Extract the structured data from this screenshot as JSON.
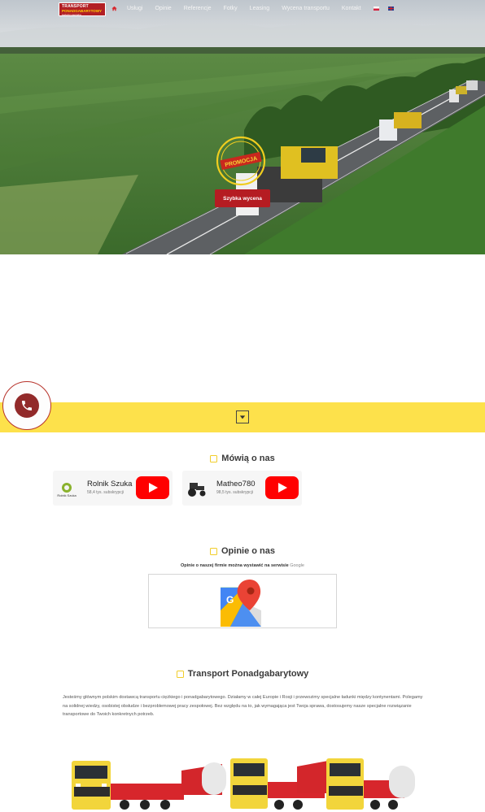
{
  "header": {
    "logo": {
      "line1": "TRANSPORT",
      "line2": "PONADGABARYTOWY",
      "line3": "Ładunki specjalne"
    },
    "nav": [
      {
        "label": "Usługi"
      },
      {
        "label": "Opinie"
      },
      {
        "label": "Referencje"
      },
      {
        "label": "Fotky"
      },
      {
        "label": "Leasing"
      },
      {
        "label": "Wycena transportu"
      },
      {
        "label": "Kontakt"
      }
    ],
    "languages": [
      "pl",
      "en"
    ]
  },
  "hero": {
    "cta_label": "Szybka wycena",
    "stamp_text": "PROMOCJA"
  },
  "colors": {
    "brand_red": "#b51c22",
    "accent_yellow": "#fde14b",
    "youtube_red": "#ff0000"
  },
  "mowia": {
    "title": "Mówią o nas",
    "channels": [
      {
        "name": "Rolnik Szuka",
        "subs": "58,4 tys. subskrypcji",
        "thumb_label": "Rolnik Szuka"
      },
      {
        "name": "Matheo780",
        "subs": "98,5 tys. subskrypcji"
      }
    ]
  },
  "opinie": {
    "title": "Opinie o nas",
    "note": "Opinie o naszej firmie można wystawić na serwisie",
    "note_link": "Google"
  },
  "transport": {
    "title": "Transport Ponadgabarytowy",
    "body": "Jesteśmy głównym polskim dostawcą transportu ciężkiego i ponadgabarytowego. Działamy w całej Europie i Rosji i przewozimy specjalne ładunki między kontynentami. Polegamy na solidnej wiedzy, osobistej obsłudze i bezproblemowej pracy zespołowej. Bez względu na to, jak wymagająca jest Twoja sprawa, dostosujemy nasze specjalne rozwiązanie transportowe do Twoich konkretnych potrzeb."
  }
}
